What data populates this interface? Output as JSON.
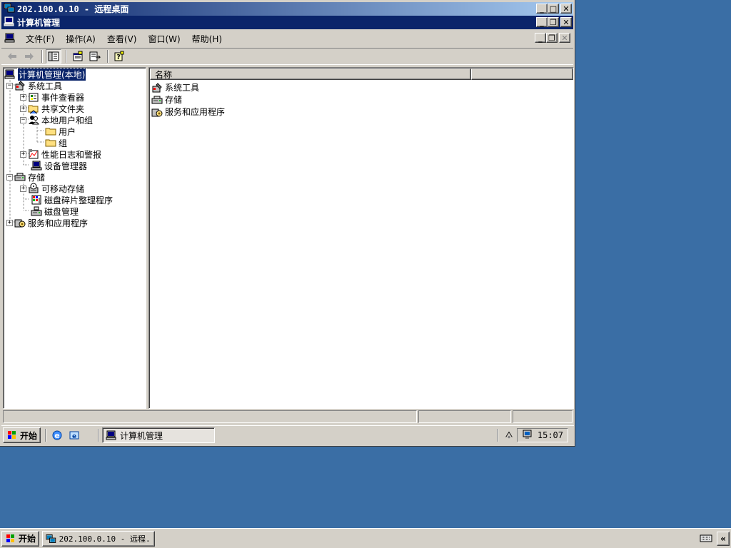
{
  "rdp_window": {
    "title": "202.100.0.10 - 远程桌面"
  },
  "mmc": {
    "title": "计算机管理",
    "menu": [
      {
        "label": "文件(F)"
      },
      {
        "label": "操作(A)"
      },
      {
        "label": "查看(V)"
      },
      {
        "label": "窗口(W)"
      },
      {
        "label": "帮助(H)"
      }
    ]
  },
  "tree": {
    "root": "计算机管理(本地)",
    "items": [
      {
        "label": "系统工具"
      },
      {
        "label": "事件查看器"
      },
      {
        "label": "共享文件夹"
      },
      {
        "label": "本地用户和组"
      },
      {
        "label": "用户"
      },
      {
        "label": "组"
      },
      {
        "label": "性能日志和警报"
      },
      {
        "label": "设备管理器"
      },
      {
        "label": "存储"
      },
      {
        "label": "可移动存储"
      },
      {
        "label": "磁盘碎片整理程序"
      },
      {
        "label": "磁盘管理"
      },
      {
        "label": "服务和应用程序"
      }
    ]
  },
  "list": {
    "column_name": "名称",
    "rows": [
      {
        "label": "系统工具"
      },
      {
        "label": "存储"
      },
      {
        "label": "服务和应用程序"
      }
    ]
  },
  "inner_taskbar": {
    "start_label": "开始",
    "task_label": "计算机管理",
    "clock": "15:07"
  },
  "local_taskbar": {
    "start_label": "开始",
    "task_label": "202.100.0.10 - 远程..."
  },
  "colors": {
    "desktop": "#3a6ea5",
    "titlebar_active": "#0a246a",
    "face": "#d4d0c8"
  }
}
